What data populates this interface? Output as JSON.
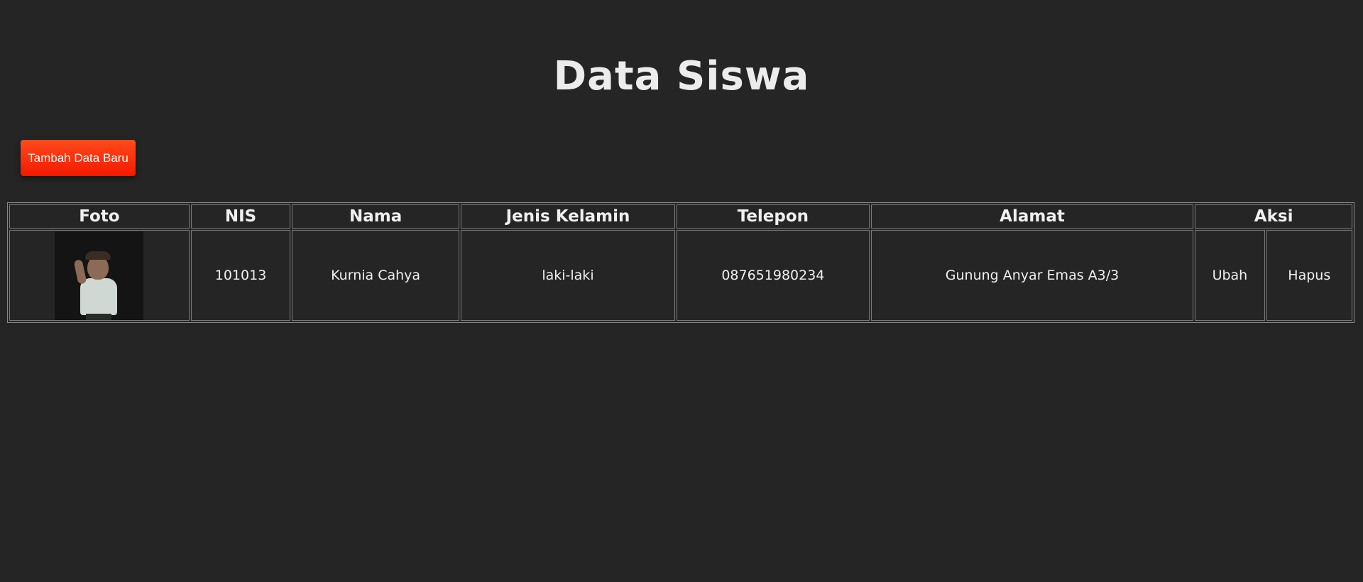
{
  "page": {
    "title": "Data Siswa"
  },
  "toolbar": {
    "add_label": "Tambah Data Baru"
  },
  "table": {
    "headers": {
      "foto": "Foto",
      "nis": "NIS",
      "nama": "Nama",
      "jenis_kelamin": "Jenis Kelamin",
      "telepon": "Telepon",
      "alamat": "Alamat",
      "aksi": "Aksi"
    },
    "rows": [
      {
        "nis": "101013",
        "nama": "Kurnia Cahya",
        "jenis_kelamin": "laki-laki",
        "telepon": "087651980234",
        "alamat": "Gunung Anyar Emas A3/3",
        "edit_label": "Ubah",
        "delete_label": "Hapus"
      }
    ]
  },
  "colors": {
    "background": "#252525",
    "button": "#f8300c",
    "text": "#f2f2f2"
  }
}
